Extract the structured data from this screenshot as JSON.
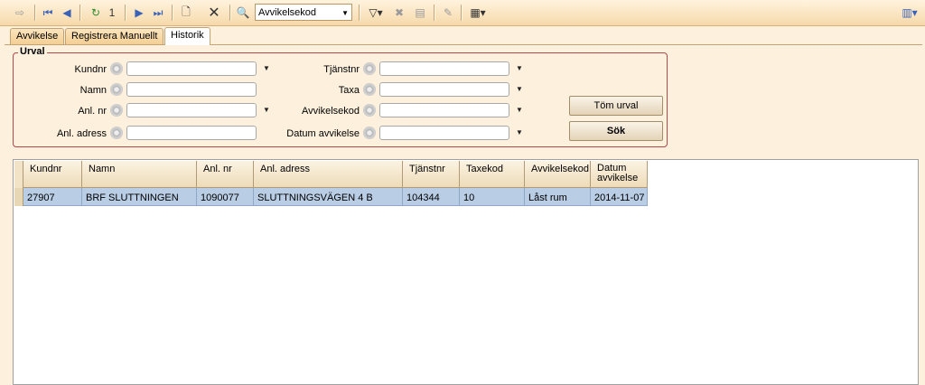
{
  "toolbar": {
    "page_number": "1",
    "search_field": "Avvikelsekod"
  },
  "tabs": [
    {
      "label": "Avvikelse"
    },
    {
      "label": "Registrera Manuellt"
    },
    {
      "label": "Historik"
    }
  ],
  "urval": {
    "title": "Urval",
    "left_fields": [
      {
        "label": "Kundnr"
      },
      {
        "label": "Namn"
      },
      {
        "label": "Anl. nr"
      },
      {
        "label": "Anl. adress"
      }
    ],
    "right_fields": [
      {
        "label": "Tjänstnr"
      },
      {
        "label": "Taxa"
      },
      {
        "label": "Avvikelsekod"
      },
      {
        "label": "Datum avvikelse"
      }
    ],
    "clear_button": "Töm urval",
    "search_button": "Sök"
  },
  "grid": {
    "columns": [
      "Kundnr",
      "Namn",
      "Anl. nr",
      "Anl. adress",
      "Tjänstnr",
      "Taxekod",
      "Avvikelsekod",
      "Datum\navvikelse"
    ],
    "rows": [
      [
        "27907",
        "BRF SLUTTNINGEN",
        "1090077",
        "SLUTTNINGSVÄGEN 4 B",
        "104344",
        "10",
        "Låst rum",
        "2014-11-07"
      ]
    ]
  }
}
